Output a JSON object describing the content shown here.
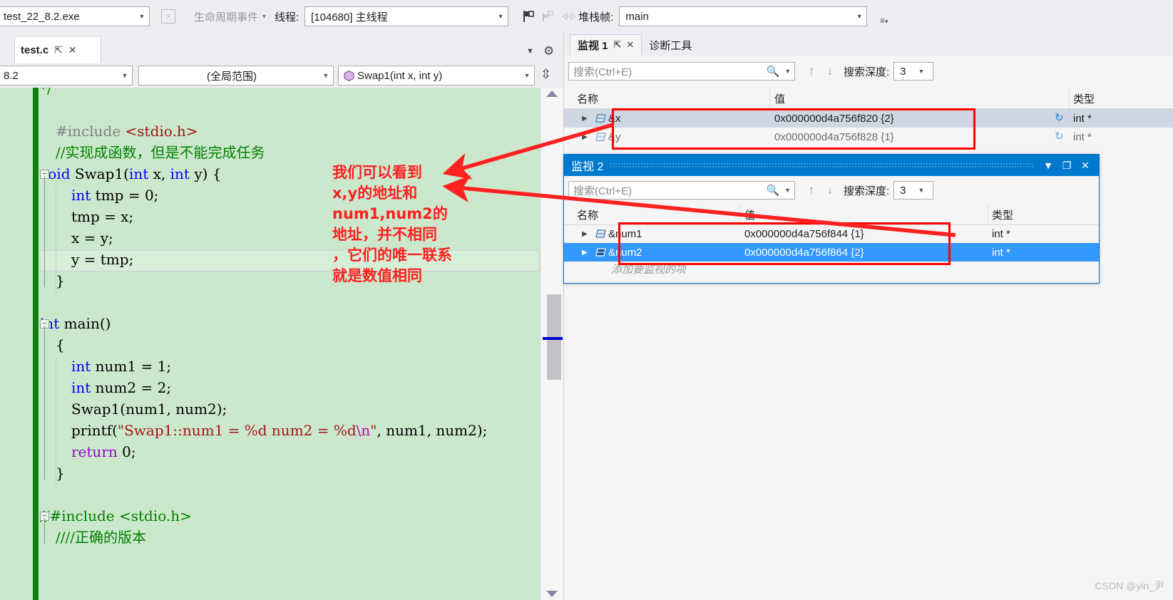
{
  "debug_toolbar": {
    "process": "test_22_8.2.exe",
    "lifecycle_events": "生命周期事件",
    "thread_label": "线程:",
    "thread_value": "[104680] 主线程",
    "stackframe_label": "堆栈帧:",
    "stackframe_value": "main",
    "icons": [
      "flag-icon",
      "flags-multiple-icon",
      "link-toggle-icon",
      "options-icon"
    ]
  },
  "editor": {
    "tab_name": "test.c",
    "tab_pin": "pin-icon",
    "tab_close": "close-icon",
    "dropdown_chevron": "chevron-down-icon",
    "settings_gear": "gear-icon",
    "nav_project": "8.2",
    "nav_scope": "(全局范围)",
    "nav_member": "Swap1(int x, int y)",
    "split_icon": "split-editor-icon",
    "code_lines": [
      {
        "indent": 0,
        "fold": false,
        "segs": [
          {
            "t": "*/",
            "c": "cmt"
          }
        ]
      },
      {
        "indent": 0,
        "fold": false,
        "segs": []
      },
      {
        "indent": 1,
        "fold": false,
        "segs": [
          {
            "t": "#include ",
            "c": "pp"
          },
          {
            "t": "<stdio.h>",
            "c": "str"
          }
        ]
      },
      {
        "indent": 1,
        "fold": false,
        "segs": [
          {
            "t": "//实现成函数，但是不能完成任务",
            "c": "cmt"
          }
        ]
      },
      {
        "indent": 0,
        "fold": true,
        "segs": [
          {
            "t": "void ",
            "c": "kw"
          },
          {
            "t": "Swap1(",
            "c": "pln"
          },
          {
            "t": "int ",
            "c": "kw"
          },
          {
            "t": "x, ",
            "c": "pln"
          },
          {
            "t": "int ",
            "c": "kw"
          },
          {
            "t": "y) {",
            "c": "pln"
          }
        ]
      },
      {
        "indent": 2,
        "fold": false,
        "segs": [
          {
            "t": "int ",
            "c": "kw"
          },
          {
            "t": "tmp = 0;",
            "c": "pln"
          }
        ]
      },
      {
        "indent": 2,
        "fold": false,
        "segs": [
          {
            "t": "tmp = x;",
            "c": "pln"
          }
        ]
      },
      {
        "indent": 2,
        "fold": false,
        "segs": [
          {
            "t": "x = y;",
            "c": "pln"
          }
        ]
      },
      {
        "indent": 2,
        "fold": false,
        "segs": [
          {
            "t": "y = tmp;",
            "c": "pln"
          }
        ]
      },
      {
        "indent": 1,
        "fold": false,
        "segs": [
          {
            "t": "}",
            "c": "pln"
          }
        ]
      },
      {
        "indent": 0,
        "fold": false,
        "segs": []
      },
      {
        "indent": 0,
        "fold": true,
        "segs": [
          {
            "t": "int ",
            "c": "kw"
          },
          {
            "t": "main()",
            "c": "pln"
          }
        ]
      },
      {
        "indent": 1,
        "fold": false,
        "segs": [
          {
            "t": "{",
            "c": "pln"
          }
        ]
      },
      {
        "indent": 2,
        "fold": false,
        "segs": [
          {
            "t": "int ",
            "c": "kw"
          },
          {
            "t": "num1 = 1;",
            "c": "pln"
          }
        ]
      },
      {
        "indent": 2,
        "fold": false,
        "segs": [
          {
            "t": "int ",
            "c": "kw"
          },
          {
            "t": "num2 = 2;",
            "c": "pln"
          }
        ]
      },
      {
        "indent": 2,
        "fold": false,
        "segs": [
          {
            "t": "Swap1(num1, num2);",
            "c": "pln"
          }
        ]
      },
      {
        "indent": 2,
        "fold": false,
        "segs": [
          {
            "t": "printf(",
            "c": "pln"
          },
          {
            "t": "\"Swap1::num1 = %d num2 = %d",
            "c": "str"
          },
          {
            "t": "\\n",
            "c": "esc"
          },
          {
            "t": "\"",
            "c": "str"
          },
          {
            "t": ", num1, num2);",
            "c": "pln"
          }
        ]
      },
      {
        "indent": 2,
        "fold": false,
        "segs": [
          {
            "t": "return ",
            "c": "kw2"
          },
          {
            "t": "0;",
            "c": "pln"
          }
        ]
      },
      {
        "indent": 1,
        "fold": false,
        "segs": [
          {
            "t": "}",
            "c": "pln"
          }
        ]
      },
      {
        "indent": 0,
        "fold": false,
        "segs": []
      },
      {
        "indent": 0,
        "fold": true,
        "segs": [
          {
            "t": "//#include <stdio.h>",
            "c": "cmt"
          }
        ]
      },
      {
        "indent": 1,
        "fold": false,
        "segs": [
          {
            "t": "////正确的版本",
            "c": "cmt"
          }
        ]
      }
    ],
    "current_line_index": 8
  },
  "watch1": {
    "tab_active": "监视 1",
    "tab_pin": "pin-icon",
    "tab_close": "close-icon",
    "tab_inactive": "诊断工具",
    "search_placeholder": "搜索(Ctrl+E)",
    "search_icon": "magnifier-icon",
    "search_dropdown": "chevron-down-icon",
    "prev_icon": "arrow-up-icon",
    "next_icon": "arrow-down-icon",
    "depth_label": "搜索深度:",
    "depth_value": "3",
    "columns": [
      "名称",
      "值",
      "类型"
    ],
    "rows": [
      {
        "expander": "expand-triangle-icon",
        "icon": "pointer-variable-icon",
        "name": "&x",
        "value": "0x000000d4a756f820 {2}",
        "refresh": "refresh-icon",
        "type": "int *",
        "selected": true
      },
      {
        "expander": "expand-triangle-icon",
        "icon": "pointer-variable-icon",
        "name": "&y",
        "value": "0x000000d4a756f828 {1}",
        "refresh": "refresh-icon",
        "type": "int *",
        "selected": false
      }
    ]
  },
  "watch2": {
    "title": "监视 2",
    "title_buttons": [
      "chevron-down-icon",
      "maximize-icon",
      "close-icon"
    ],
    "search_placeholder": "搜索(Ctrl+E)",
    "search_icon": "magnifier-icon",
    "search_dropdown": "chevron-down-icon",
    "prev_icon": "arrow-up-icon",
    "next_icon": "arrow-down-icon",
    "depth_label": "搜索深度:",
    "depth_value": "3",
    "columns": [
      "名称",
      "值",
      "类型"
    ],
    "rows": [
      {
        "expander": "expand-triangle-icon",
        "icon": "pointer-variable-icon",
        "name": "&num1",
        "value": "0x000000d4a756f844 {1}",
        "type": "int *",
        "selected": false
      },
      {
        "expander": "expand-triangle-icon",
        "icon": "pointer-variable-icon",
        "name": "&num2",
        "value": "0x000000d4a756f864 {2}",
        "type": "int *",
        "selected": true
      }
    ],
    "add_item_hint": "添加要监视的项"
  },
  "annotation": {
    "color": "#ff2020",
    "lines": [
      "我们可以看到",
      "x,y的地址和",
      "num1,num2的",
      "地址，并不相同",
      "，它们的唯一联系",
      "就是数值相同"
    ]
  },
  "watermark": "CSDN @yin_尹"
}
